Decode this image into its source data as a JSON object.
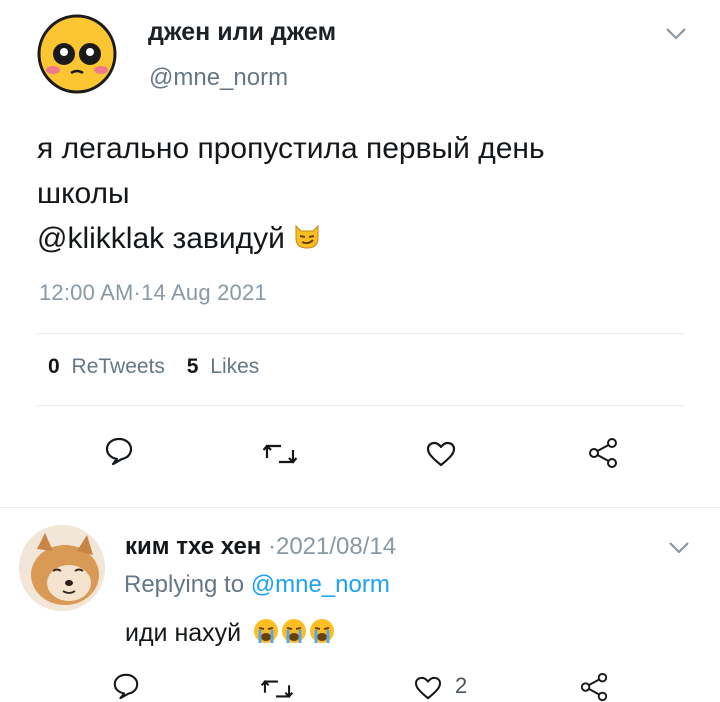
{
  "tweet": {
    "author_name": "джен или джем",
    "author_handle": "@mne_norm",
    "text_line1": "я легально пропустила первый день",
    "text_line2": "школы",
    "text_line3_mention": "@klikklak",
    "text_line3_rest": " завидуй",
    "timestamp": "12:00 AM·14 Aug 2021",
    "retweets_count": "0",
    "retweets_label": "ReTweets",
    "likes_count": "5",
    "likes_label": "Likes"
  },
  "reply": {
    "author_name": "ким тхе хен",
    "date": "·2021/08/14",
    "replying_prefix": "Replying to ",
    "replying_handle": "@mne_norm",
    "text": "иди нахуй",
    "likes_count": "2"
  },
  "icons": {
    "reply": "speech-bubble-icon",
    "retweet": "retweet-icon",
    "like": "heart-icon",
    "share": "share-icon",
    "menu": "chevron-down-icon"
  },
  "colors": {
    "text_primary": "#14171a",
    "text_secondary": "#657786",
    "link": "#1da1f2",
    "divider": "#e6ecf0"
  }
}
